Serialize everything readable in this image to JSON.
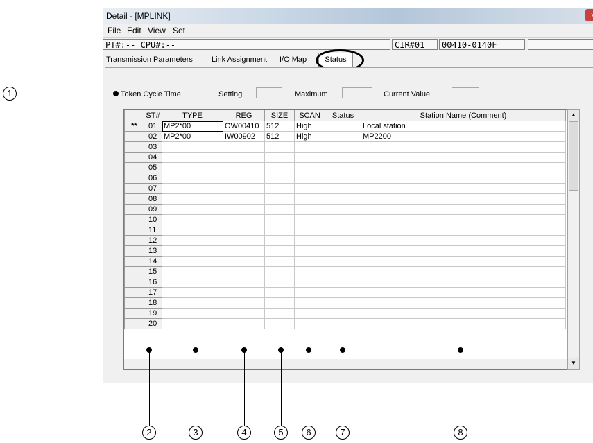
{
  "window": {
    "title": "Detail - [MPLINK]",
    "close_glyph": "x"
  },
  "menu": [
    "File",
    "Edit",
    "View",
    "Set"
  ],
  "infobar": {
    "pt_cpu": "PT#:-- CPU#:--",
    "cir": "CIR#01",
    "code": "00410-0140F"
  },
  "tabs": [
    "Transmission Parameters",
    "Link Assignment",
    "I/O Map",
    "Status"
  ],
  "token": {
    "label": "Token Cycle Time",
    "setting_label": "Setting",
    "maximum_label": "Maximum",
    "current_label": "Current Value"
  },
  "table": {
    "columns": [
      "ST#",
      "TYPE",
      "REG",
      "SIZE",
      "SCAN",
      "Status",
      "Station Name (Comment)"
    ],
    "rows": [
      {
        "mark": "**",
        "st": "01",
        "type": "MP2*00",
        "reg": "OW00410",
        "size": "512",
        "scan": "High",
        "status": "",
        "name": "Local station"
      },
      {
        "mark": "",
        "st": "02",
        "type": "MP2*00",
        "reg": "IW00902",
        "size": "512",
        "scan": "High",
        "status": "",
        "name": "MP2200"
      },
      {
        "mark": "",
        "st": "03",
        "type": "",
        "reg": "",
        "size": "",
        "scan": "",
        "status": "",
        "name": ""
      },
      {
        "mark": "",
        "st": "04",
        "type": "",
        "reg": "",
        "size": "",
        "scan": "",
        "status": "",
        "name": ""
      },
      {
        "mark": "",
        "st": "05",
        "type": "",
        "reg": "",
        "size": "",
        "scan": "",
        "status": "",
        "name": ""
      },
      {
        "mark": "",
        "st": "06",
        "type": "",
        "reg": "",
        "size": "",
        "scan": "",
        "status": "",
        "name": ""
      },
      {
        "mark": "",
        "st": "07",
        "type": "",
        "reg": "",
        "size": "",
        "scan": "",
        "status": "",
        "name": ""
      },
      {
        "mark": "",
        "st": "08",
        "type": "",
        "reg": "",
        "size": "",
        "scan": "",
        "status": "",
        "name": ""
      },
      {
        "mark": "",
        "st": "09",
        "type": "",
        "reg": "",
        "size": "",
        "scan": "",
        "status": "",
        "name": ""
      },
      {
        "mark": "",
        "st": "10",
        "type": "",
        "reg": "",
        "size": "",
        "scan": "",
        "status": "",
        "name": ""
      },
      {
        "mark": "",
        "st": "11",
        "type": "",
        "reg": "",
        "size": "",
        "scan": "",
        "status": "",
        "name": ""
      },
      {
        "mark": "",
        "st": "12",
        "type": "",
        "reg": "",
        "size": "",
        "scan": "",
        "status": "",
        "name": ""
      },
      {
        "mark": "",
        "st": "13",
        "type": "",
        "reg": "",
        "size": "",
        "scan": "",
        "status": "",
        "name": ""
      },
      {
        "mark": "",
        "st": "14",
        "type": "",
        "reg": "",
        "size": "",
        "scan": "",
        "status": "",
        "name": ""
      },
      {
        "mark": "",
        "st": "15",
        "type": "",
        "reg": "",
        "size": "",
        "scan": "",
        "status": "",
        "name": ""
      },
      {
        "mark": "",
        "st": "16",
        "type": "",
        "reg": "",
        "size": "",
        "scan": "",
        "status": "",
        "name": ""
      },
      {
        "mark": "",
        "st": "17",
        "type": "",
        "reg": "",
        "size": "",
        "scan": "",
        "status": "",
        "name": ""
      },
      {
        "mark": "",
        "st": "18",
        "type": "",
        "reg": "",
        "size": "",
        "scan": "",
        "status": "",
        "name": ""
      },
      {
        "mark": "",
        "st": "19",
        "type": "",
        "reg": "",
        "size": "",
        "scan": "",
        "status": "",
        "name": ""
      },
      {
        "mark": "",
        "st": "20",
        "type": "",
        "reg": "",
        "size": "",
        "scan": "",
        "status": "",
        "name": ""
      }
    ]
  },
  "callouts": [
    "1",
    "2",
    "3",
    "4",
    "5",
    "6",
    "7",
    "8"
  ],
  "icons": {
    "scroll_up": "triangle-up",
    "scroll_down": "triangle-down"
  }
}
